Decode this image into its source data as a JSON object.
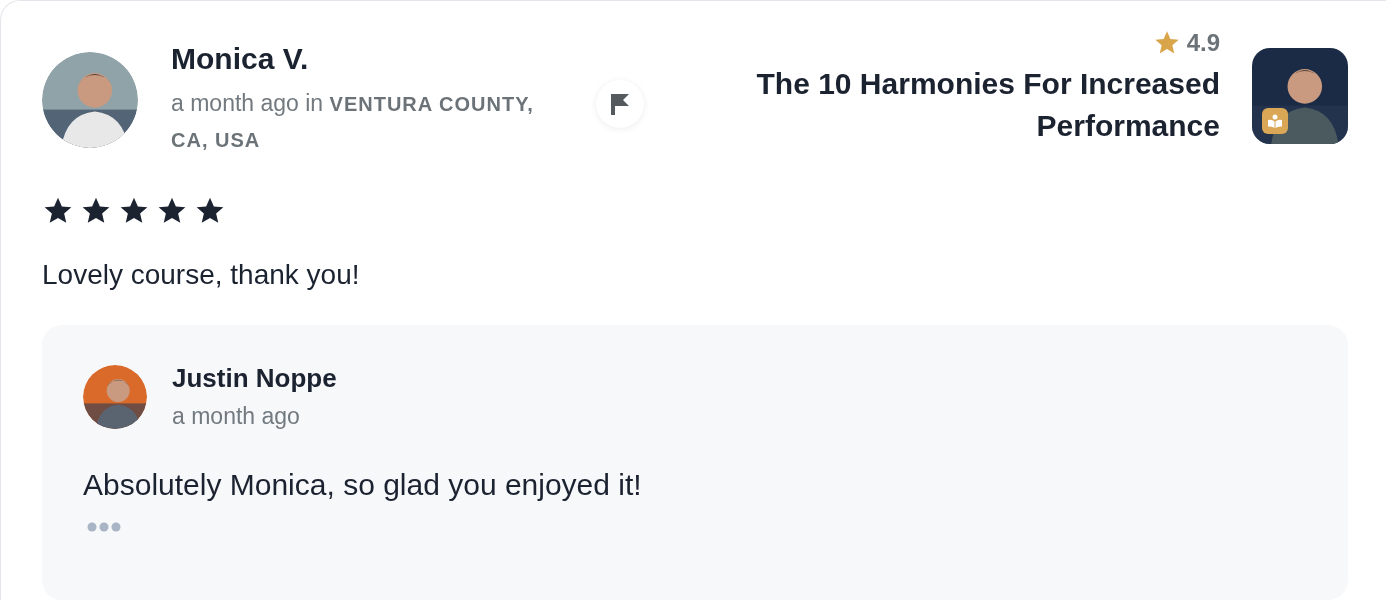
{
  "review": {
    "author": "Monica V.",
    "meta": "a month ago in **VENTURA COUNTY, CA, USA**",
    "stars": 5,
    "text": "Lovely course, thank you!"
  },
  "course": {
    "rating": "4.9",
    "title": "The 10 Harmonies For Increased Performance"
  },
  "reply": {
    "author": "Justin Noppe",
    "time": "a month ago",
    "text": "Absolutely Monica, so glad you enjoyed it!"
  }
}
